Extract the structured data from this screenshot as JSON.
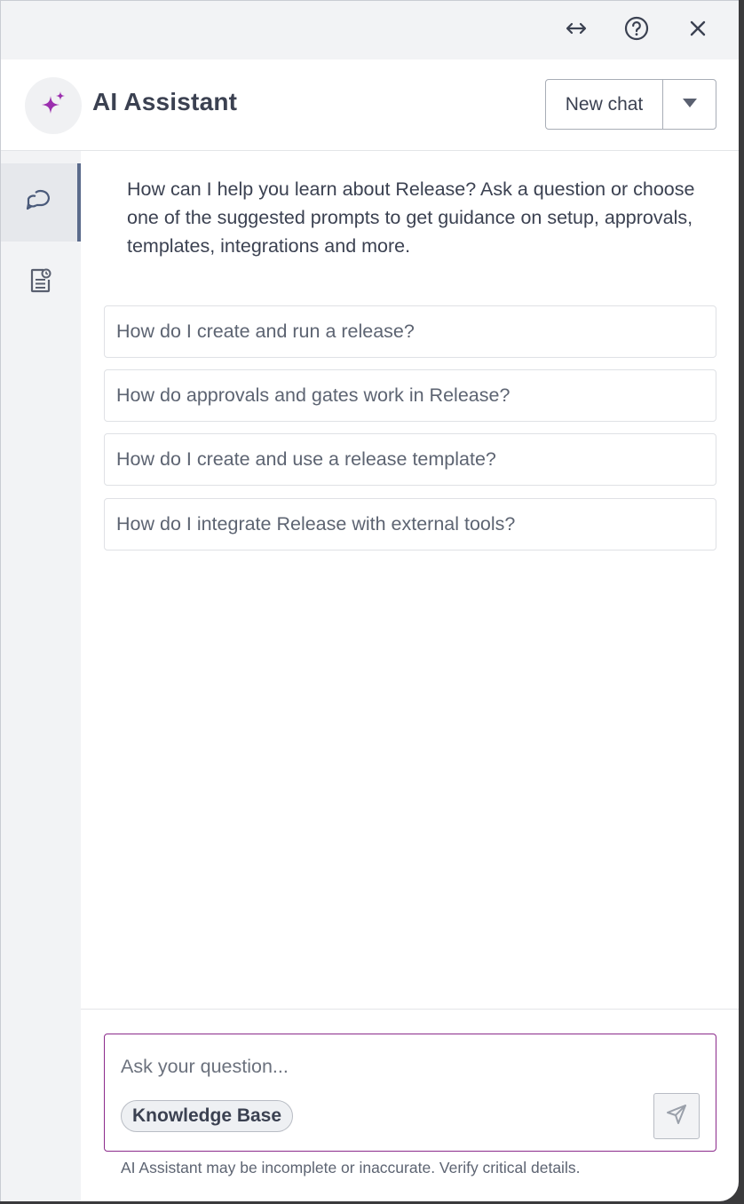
{
  "topbar": {
    "expand_icon": "horizontal-expand-arrows-icon",
    "help_icon": "question-circle-icon",
    "close_icon": "close-x-icon"
  },
  "header": {
    "title": "AI Assistant",
    "avatar_icon": "sparkle-icon",
    "new_chat_label": "New chat",
    "dropdown_icon": "caret-down-icon"
  },
  "sidebar": {
    "items": [
      {
        "icon": "chat-bubbles-icon",
        "active": true
      },
      {
        "icon": "document-history-icon",
        "active": false
      }
    ]
  },
  "main": {
    "intro": "How can I help you learn about Release? Ask a question or choose one of the suggested prompts to get guidance on setup, approvals, templates, integrations and more.",
    "prompts": [
      "How do I create and run a release?",
      "How do approvals and gates work in Release?",
      "How do I create and use a release template?",
      "How do I integrate Release with external tools?"
    ]
  },
  "composer": {
    "placeholder": "Ask your question...",
    "value": "",
    "chip_label": "Knowledge Base",
    "send_icon": "paper-plane-send-icon",
    "disclaimer": "AI Assistant may be incomplete or inaccurate. Verify critical details."
  },
  "colors": {
    "accent_sparkle": "#9b2fae",
    "input_border": "#8b2a8b",
    "active_indicator": "#5b6b8c",
    "text_primary": "#3b4151"
  }
}
